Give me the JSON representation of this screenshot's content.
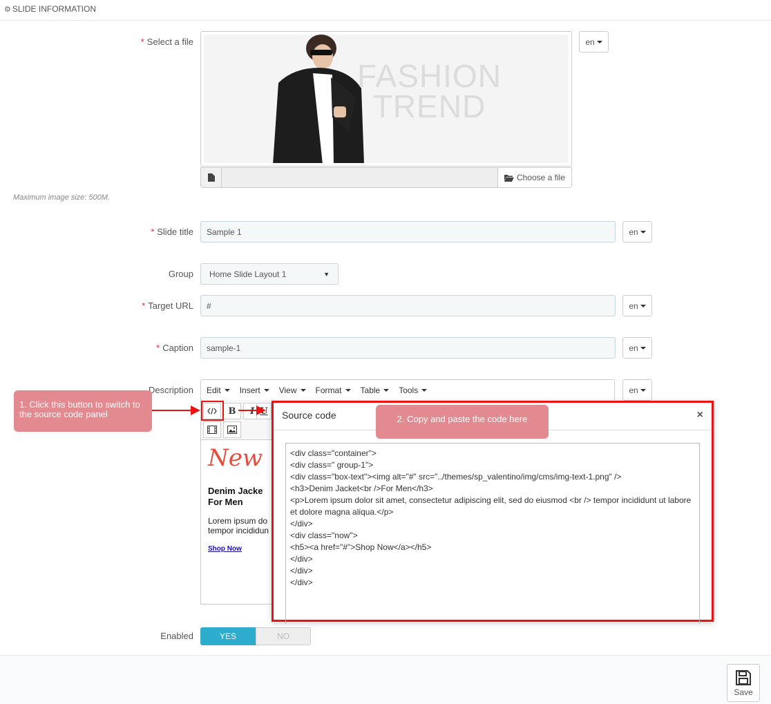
{
  "panel": {
    "title": "SLIDE INFORMATION"
  },
  "fields": {
    "select_file_label": "Select a file",
    "choose_file_label": "Choose a file",
    "max_size_hint": "Maximum image size: 500M.",
    "preview_text_line1": "FASHION",
    "preview_text_line2": "TREND",
    "slide_title_label": "Slide title",
    "slide_title_value": "Sample 1",
    "group_label": "Group",
    "group_value": "Home Slide Layout 1",
    "target_url_label": "Target URL",
    "target_url_value": "#",
    "caption_label": "Caption",
    "caption_value": "sample-1",
    "description_label": "Description",
    "enabled_label": "Enabled",
    "enabled_yes": "YES",
    "enabled_no": "NO",
    "lang": "en",
    "required_mark": "*"
  },
  "editor": {
    "menus": [
      "Edit",
      "Insert",
      "View",
      "Format",
      "Table",
      "Tools"
    ],
    "preview_script": "New",
    "preview_heading_line1": "Denim Jacke",
    "preview_heading_line2": "For Men",
    "preview_para_line1": "Lorem ipsum do",
    "preview_para_line2": "tempor incididun",
    "preview_link": "Shop Now"
  },
  "modal": {
    "title": "Source code",
    "close": "×",
    "code": "<div class=\"container\">\n<div class=\" group-1\">\n<div class=\"box-text\"><img alt=\"#\" src=\"../themes/sp_valentino/img/cms/img-text-1.png\" />\n<h3>Denim Jacket<br />For Men</h3>\n<p>Lorem ipsum dolor sit amet, consectetur adipiscing elit, sed do eiusmod <br /> tempor incididunt ut labore et dolore magna aliqua.</p>\n</div>\n<div class=\"now\">\n<h5><a href=\"#\">Shop Now</a></h5>\n</div>\n</div>\n</div>"
  },
  "callouts": {
    "step1": "1. Click this button to switch to the source code panel",
    "step2": "2. Copy and paste the code here"
  },
  "footer": {
    "save_label": "Save"
  },
  "colors": {
    "accent": "#2eacce",
    "annotation_red": "#ee1111",
    "callout_pink": "#e28a8f"
  }
}
